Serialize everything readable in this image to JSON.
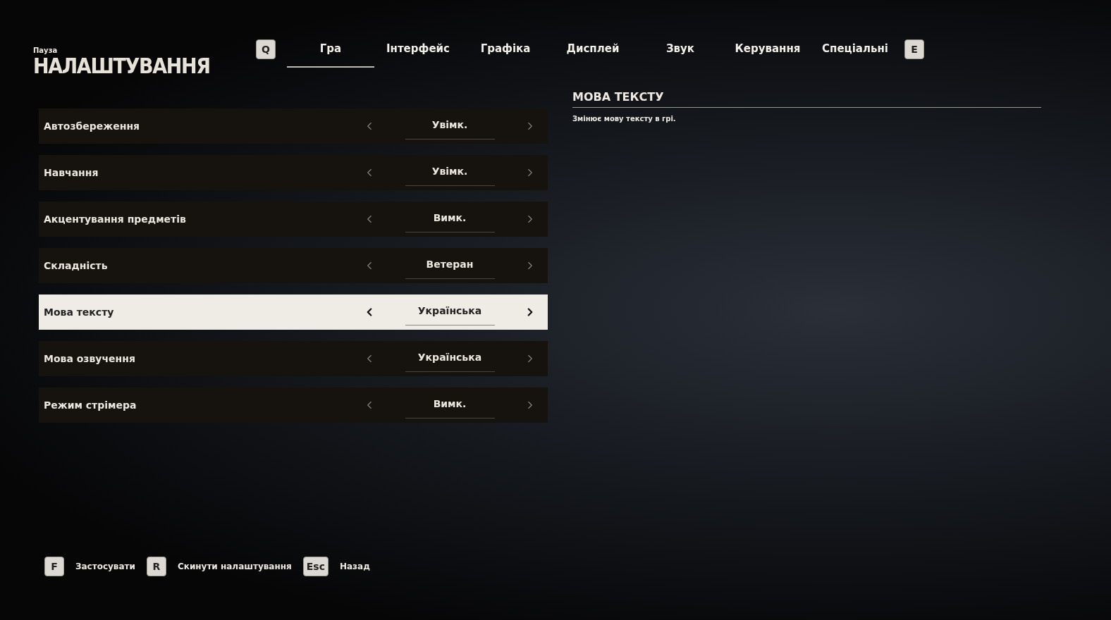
{
  "header": {
    "subtitle": "Пауза",
    "title": "НАЛАШТУВАННЯ"
  },
  "tab_keys": {
    "previous": "Q",
    "next": "E"
  },
  "tabs": [
    {
      "label": "Гра",
      "selected": true
    },
    {
      "label": "Інтерфейс",
      "selected": false
    },
    {
      "label": "Графіка",
      "selected": false
    },
    {
      "label": "Дисплей",
      "selected": false
    },
    {
      "label": "Звук",
      "selected": false
    },
    {
      "label": "Керування",
      "selected": false
    },
    {
      "label": "Спеціальні",
      "selected": false
    }
  ],
  "settings": [
    {
      "label": "Автозбереження",
      "value": "Увімк.",
      "selected": false
    },
    {
      "label": "Навчання",
      "value": "Увімк.",
      "selected": false
    },
    {
      "label": "Акцентування предметів",
      "value": "Вимк.",
      "selected": false
    },
    {
      "label": "Складність",
      "value": "Ветеран",
      "selected": false
    },
    {
      "label": "Мова тексту",
      "value": "Українська",
      "selected": true
    },
    {
      "label": "Мова озвучення",
      "value": "Українська",
      "selected": false
    },
    {
      "label": "Режим стрімера",
      "value": "Вимк.",
      "selected": false
    }
  ],
  "description": {
    "title": "МОВА ТЕКСТУ",
    "text": "Змінює мову тексту в грі."
  },
  "actions": [
    {
      "key": "F",
      "label": "Застосувати"
    },
    {
      "key": "R",
      "label": "Скинути налаштування"
    },
    {
      "key": "Esc",
      "label": "Назад"
    }
  ]
}
